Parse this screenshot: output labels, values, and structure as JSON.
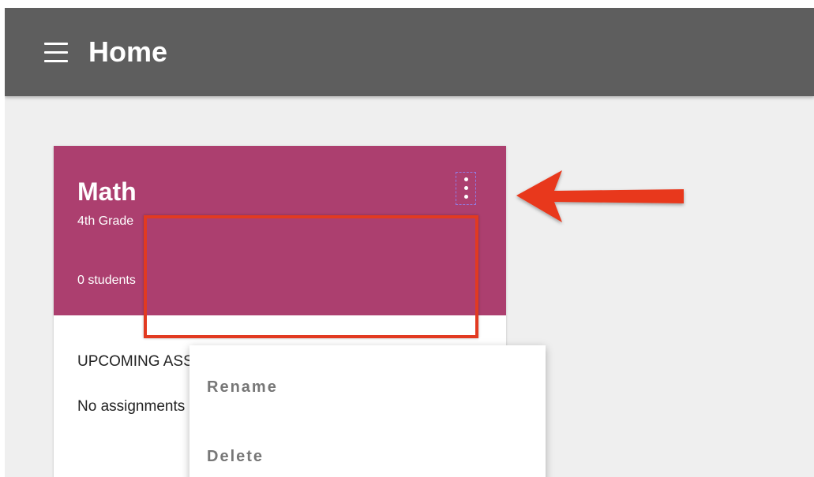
{
  "app_bar": {
    "title": "Home",
    "menu_icon": "hamburger-menu-icon",
    "color": "#5e5e5e"
  },
  "card": {
    "title": "Math",
    "section": "4th Grade",
    "students": "0 students",
    "upcoming_heading": "UPCOMING ASSIGNMENTS",
    "assignments_empty": "No assignments",
    "header_color": "#ac3f6f",
    "more_icon": "more-vert-icon"
  },
  "menu": {
    "items": [
      {
        "label": "Rename"
      },
      {
        "label": "Delete"
      }
    ]
  },
  "annotation": {
    "highlight_color": "#e23a21",
    "arrow_icon": "red-arrow-icon"
  }
}
